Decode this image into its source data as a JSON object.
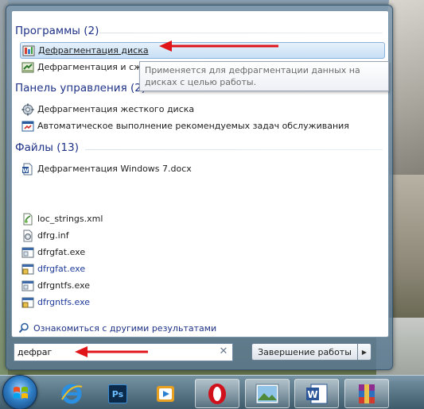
{
  "groups": {
    "programs": {
      "title": "Программы (2)",
      "items": [
        {
          "label": "Дефрагментация диска",
          "icon": "disk-defragmenter-icon"
        },
        {
          "label": "Дефрагментация и сжатие реестра",
          "icon": "registry-tool-icon"
        }
      ]
    },
    "control_panel": {
      "title": "Панель управления (2)",
      "items": [
        {
          "label": "Дефрагментация жесткого диска",
          "icon": "control-panel-gear-icon"
        },
        {
          "label": "Автоматическое выполнение рекомендуемых задач обслуживания",
          "icon": "maintenance-icon"
        }
      ]
    },
    "files": {
      "title": "Файлы (13)",
      "items": [
        {
          "label": "Дефрагментация Windows 7.docx",
          "icon": "word-document-icon"
        },
        {
          "label": "loc_strings.xml",
          "icon": "xml-file-icon"
        },
        {
          "label": "dfrg.inf",
          "icon": "inf-file-icon"
        },
        {
          "label": "dfrgfat.exe",
          "icon": "exe-file-icon"
        },
        {
          "label": "dfrgfat.exe",
          "icon": "exe-file-icon"
        },
        {
          "label": "dfrgntfs.exe",
          "icon": "exe-file-icon"
        },
        {
          "label": "dfrgntfs.exe",
          "icon": "exe-file-icon"
        }
      ]
    }
  },
  "tooltip": {
    "text": "Применяется для дефрагментации данных на дисках с целью работы."
  },
  "see_more": {
    "label": "Ознакомиться с другими результатами"
  },
  "search": {
    "value": "дефраг"
  },
  "shutdown": {
    "label": "Завершение работы"
  },
  "taskbar": {
    "items": [
      "windows-start-orb",
      "internet-explorer-icon",
      "photoshop-icon",
      "media-player-icon",
      "opera-icon",
      "image-viewer-icon",
      "word-icon",
      "winrar-icon"
    ]
  },
  "colors": {
    "group_title": "#1e3287",
    "selection": "#c7dff5",
    "annotation_arrow": "#e0151a"
  }
}
